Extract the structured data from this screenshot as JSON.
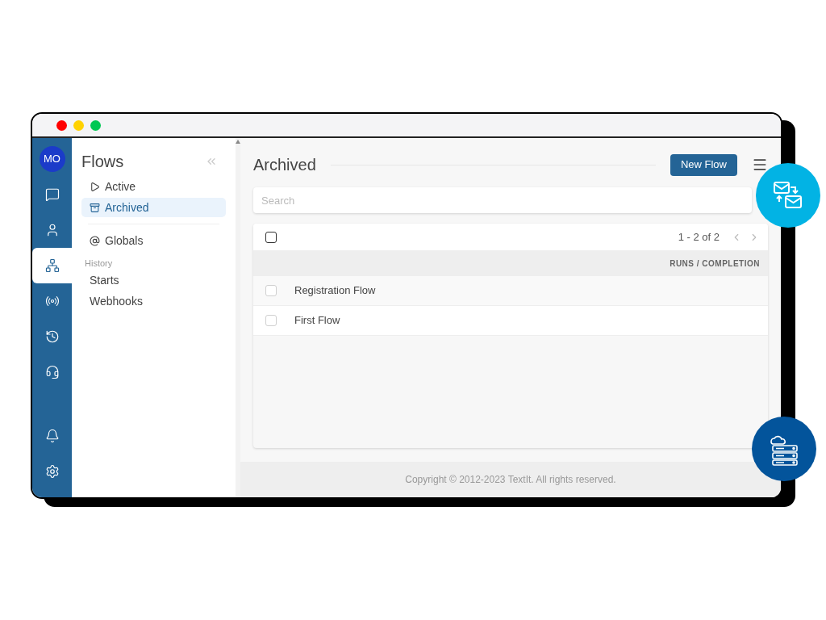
{
  "avatar": "MO",
  "rail": [
    {
      "selected": false
    },
    {
      "selected": false
    },
    {
      "selected": true
    },
    {
      "selected": false
    },
    {
      "selected": false
    },
    {
      "selected": false
    }
  ],
  "sidebar": {
    "title": "Flows",
    "items": [
      {
        "label": "Active",
        "selected": false
      },
      {
        "label": "Archived",
        "selected": true
      }
    ],
    "extra": [
      "Globals"
    ],
    "section": "History",
    "section_items": [
      "Starts",
      "Webhooks"
    ]
  },
  "main": {
    "title": "Archived",
    "button": "New Flow",
    "search": {
      "placeholder": "Search"
    },
    "table": {
      "select_all": false,
      "pagination": "1 - 2 of 2",
      "column": "RUNS / COMPLETION",
      "rows": [
        {
          "name": "Registration Flow",
          "checked": false
        },
        {
          "name": "First Flow",
          "checked": false
        }
      ]
    },
    "footer": "Copyright © 2012-2023 TextIt. All rights reserved."
  }
}
